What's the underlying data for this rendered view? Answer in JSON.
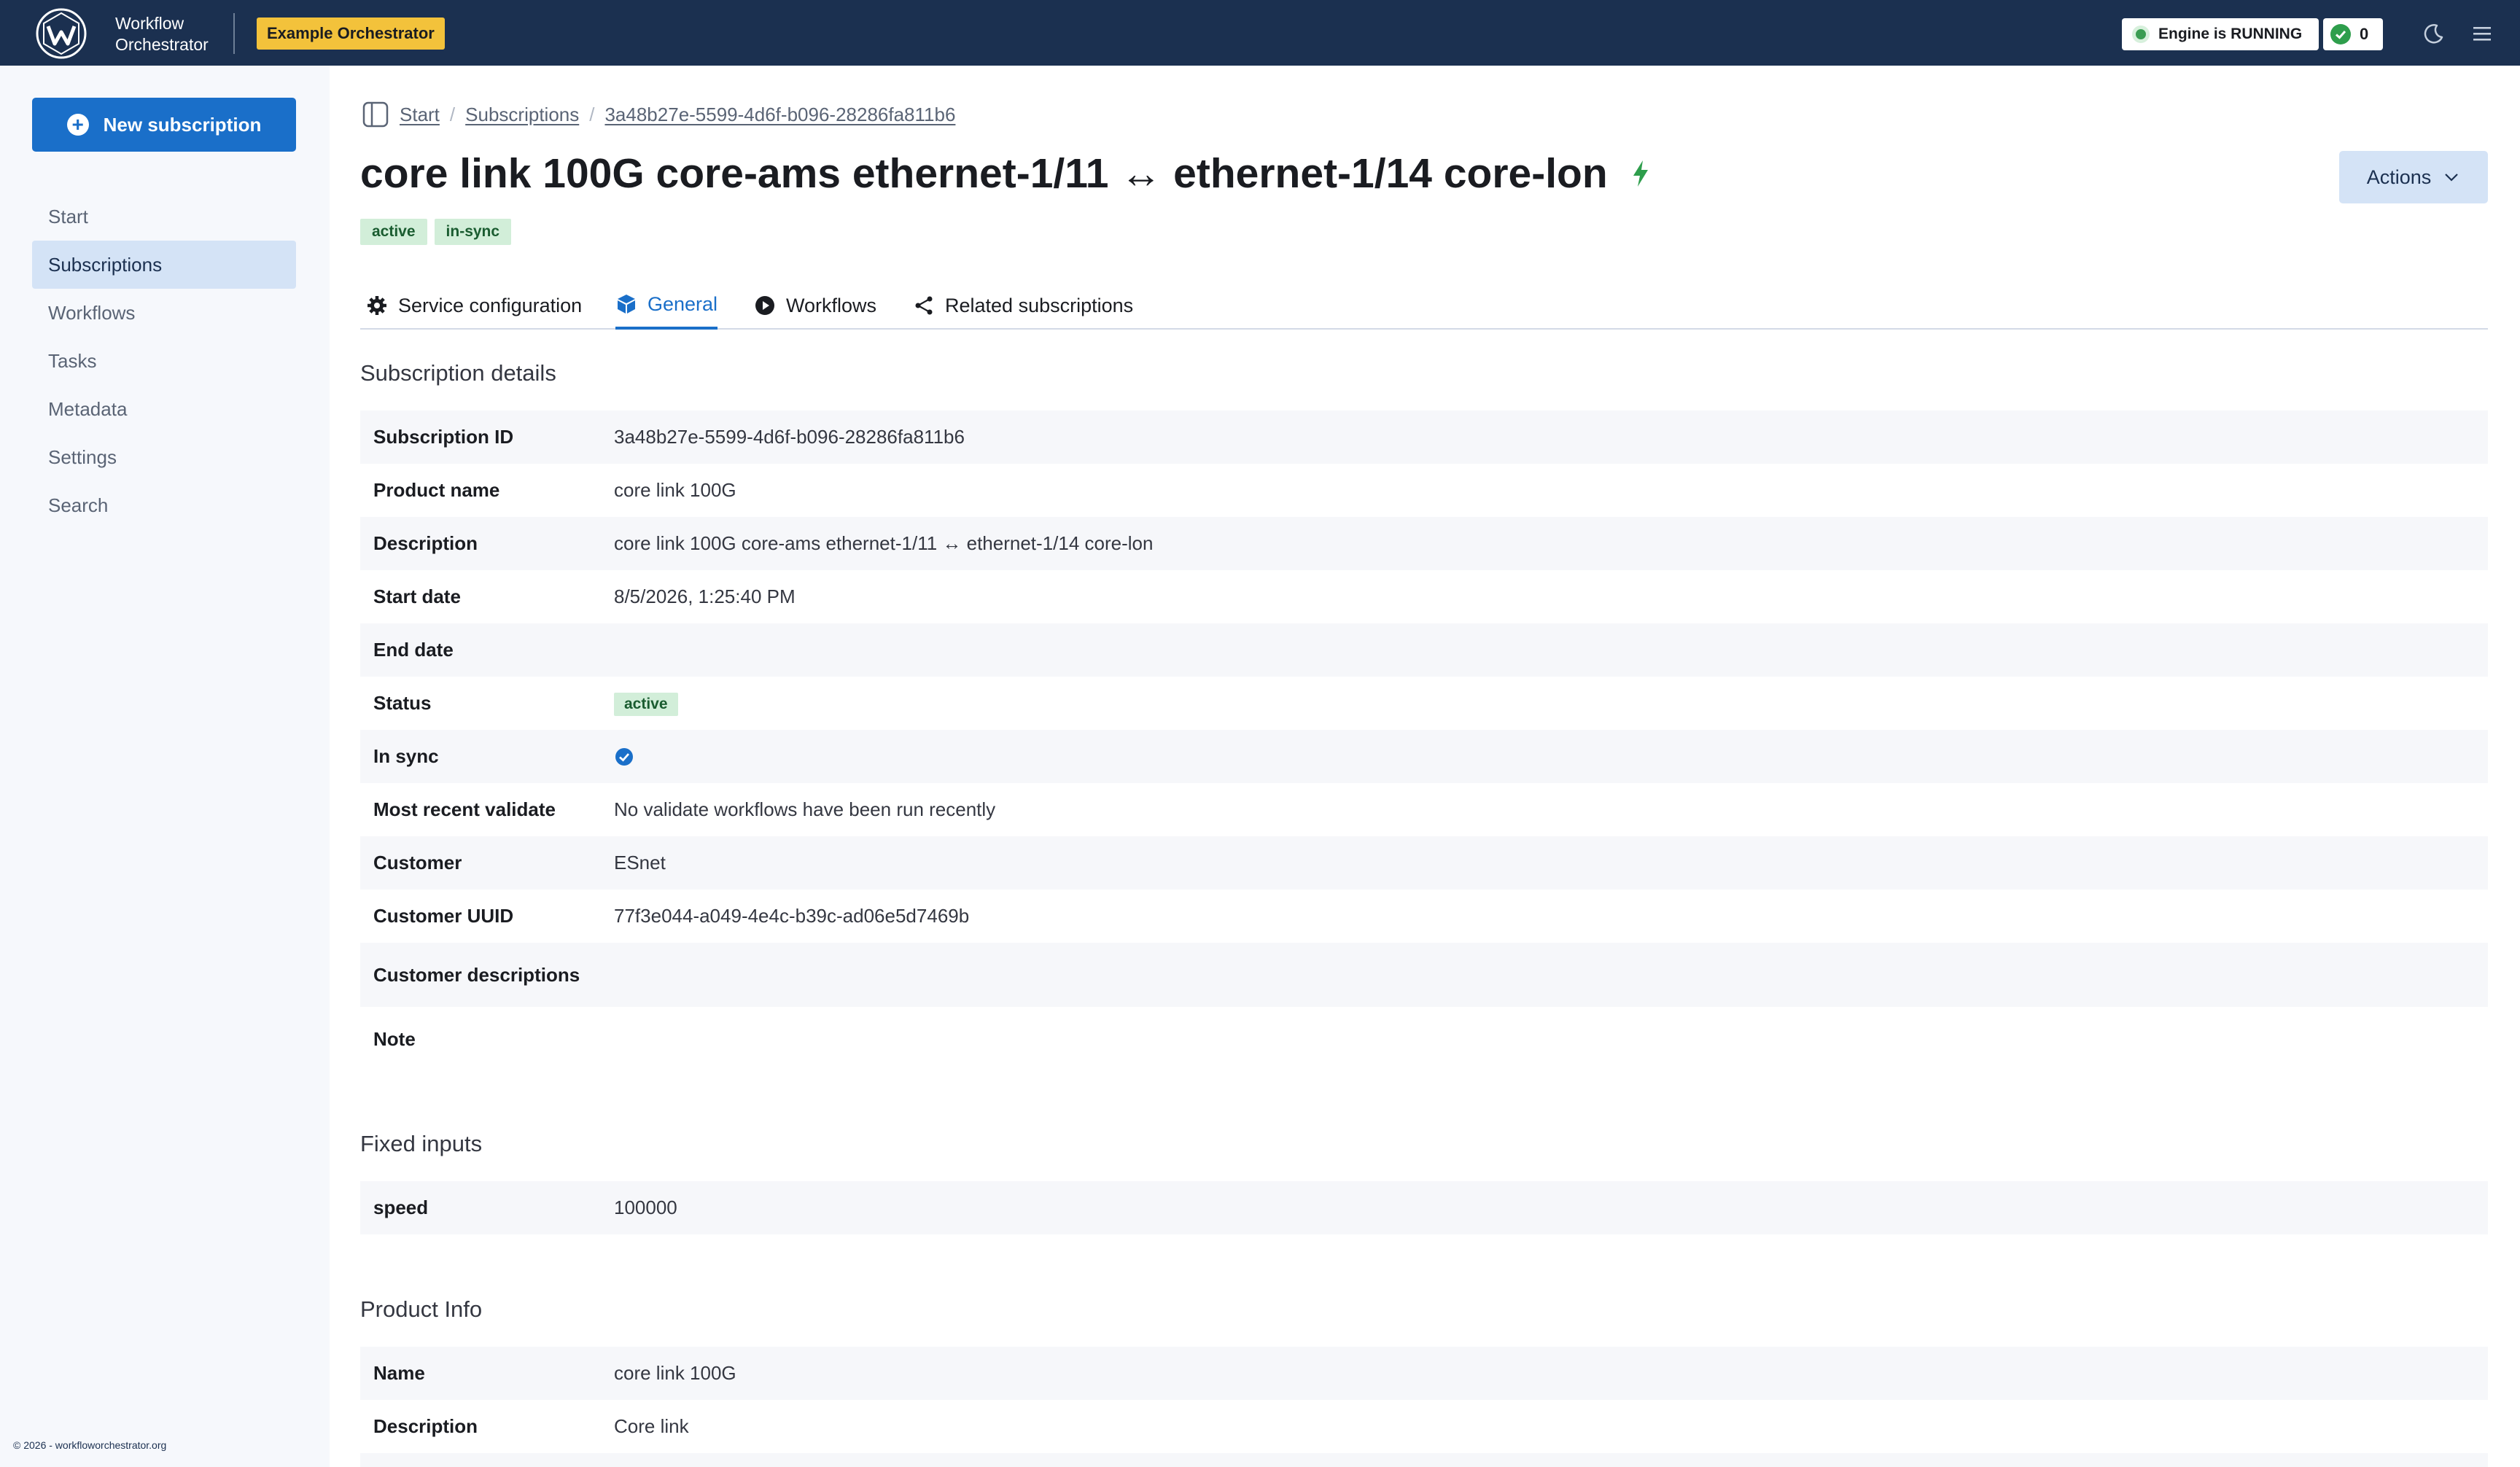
{
  "header": {
    "app_name_line1": "Workflow",
    "app_name_line2": "Orchestrator",
    "env_label": "Example Orchestrator",
    "engine_status": "Engine is RUNNING",
    "task_count": "0"
  },
  "sidebar": {
    "new_subscription": "New subscription",
    "items": [
      {
        "label": "Start"
      },
      {
        "label": "Subscriptions"
      },
      {
        "label": "Workflows"
      },
      {
        "label": "Tasks"
      },
      {
        "label": "Metadata"
      },
      {
        "label": "Settings"
      },
      {
        "label": "Search"
      }
    ],
    "footer": "© 2026 - workfloworchestrator.org"
  },
  "breadcrumb": {
    "items": [
      "Start",
      "Subscriptions",
      "3a48b27e-5599-4d6f-b096-28286fa811b6"
    ],
    "separator": "/"
  },
  "page": {
    "title": "core link 100G core-ams ethernet-1/11 ↔ ethernet-1/14 core-lon",
    "actions_label": "Actions",
    "badges": [
      "active",
      "in-sync"
    ]
  },
  "tabs": [
    {
      "label": "Service configuration",
      "icon": "gear-icon"
    },
    {
      "label": "General",
      "icon": "cube-icon"
    },
    {
      "label": "Workflows",
      "icon": "play-icon"
    },
    {
      "label": "Related subscriptions",
      "icon": "share-icon"
    }
  ],
  "subscription_details": {
    "title": "Subscription details",
    "rows": [
      {
        "key": "Subscription ID",
        "value": "3a48b27e-5599-4d6f-b096-28286fa811b6"
      },
      {
        "key": "Product name",
        "value": "core link 100G"
      },
      {
        "key": "Description",
        "value": "core link 100G core-ams ethernet-1/11 ↔ ethernet-1/14 core-lon"
      },
      {
        "key": "Start date",
        "value": "8/5/2026, 1:25:40 PM"
      },
      {
        "key": "End date",
        "value": ""
      },
      {
        "key": "Status",
        "value": "active"
      },
      {
        "key": "In sync",
        "value": ""
      },
      {
        "key": "Most recent validate",
        "value": "No validate workflows have been run recently"
      },
      {
        "key": "Customer",
        "value": "ESnet"
      },
      {
        "key": "Customer UUID",
        "value": "77f3e044-a049-4e4c-b39c-ad06e5d7469b"
      },
      {
        "key": "Customer descriptions",
        "value": ""
      },
      {
        "key": "Note",
        "value": ""
      }
    ]
  },
  "fixed_inputs": {
    "title": "Fixed inputs",
    "rows": [
      {
        "key": "speed",
        "value": "100000"
      }
    ]
  },
  "product_info": {
    "title": "Product Info",
    "rows": [
      {
        "key": "Name",
        "value": "core link 100G"
      },
      {
        "key": "Description",
        "value": "Core link"
      }
    ]
  },
  "colors": {
    "header_bg": "#1b3050",
    "accent": "#1a6fc9",
    "env_badge": "#f3c23b",
    "success": "#2e9e4c"
  }
}
